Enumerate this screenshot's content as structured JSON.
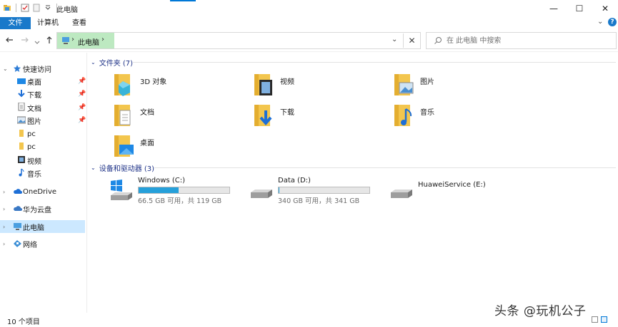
{
  "window": {
    "title": "此电脑",
    "controls": {
      "minimize": "—",
      "maximize": "☐",
      "close": "✕"
    }
  },
  "ribbon": {
    "tabs": [
      "文件",
      "计算机",
      "查看"
    ],
    "expand_glyph": "⌄",
    "help_glyph": "?"
  },
  "address": {
    "path": "此电脑",
    "search_placeholder": "在 此电脑 中搜索"
  },
  "sidebar": {
    "quick_access": "快速访问",
    "quick_items": [
      {
        "label": "桌面",
        "icon": "desktop-icon",
        "pinned": true
      },
      {
        "label": "下载",
        "icon": "download-icon",
        "pinned": true
      },
      {
        "label": "文档",
        "icon": "document-icon",
        "pinned": true
      },
      {
        "label": "图片",
        "icon": "picture-icon",
        "pinned": true
      },
      {
        "label": "pc",
        "icon": "folder-icon",
        "pinned": false
      },
      {
        "label": "pc",
        "icon": "folder-icon",
        "pinned": false
      },
      {
        "label": "视频",
        "icon": "video-icon",
        "pinned": false
      },
      {
        "label": "音乐",
        "icon": "music-icon",
        "pinned": false
      }
    ],
    "onedrive": "OneDrive",
    "huawei_cloud": "华为云盘",
    "this_pc": "此电脑",
    "network": "网络"
  },
  "content": {
    "folders_header": "文件夹 (7)",
    "folders": [
      {
        "label": "3D 对象",
        "icon": "3d-objects-folder-icon"
      },
      {
        "label": "视频",
        "icon": "videos-folder-icon"
      },
      {
        "label": "图片",
        "icon": "pictures-folder-icon"
      },
      {
        "label": "文档",
        "icon": "documents-folder-icon"
      },
      {
        "label": "下载",
        "icon": "downloads-folder-icon"
      },
      {
        "label": "音乐",
        "icon": "music-folder-icon"
      },
      {
        "label": "桌面",
        "icon": "desktop-folder-icon"
      }
    ],
    "devices_header": "设备和驱动器 (3)",
    "drives": [
      {
        "name": "Windows (C:)",
        "free": "66.5 GB 可用，共 119 GB",
        "used_fraction": 0.44,
        "icon": "windows-drive-icon"
      },
      {
        "name": "Data (D:)",
        "free": "340 GB 可用，共 341 GB",
        "used_fraction": 0.003,
        "icon": "hard-drive-icon"
      },
      {
        "name": "HuaweiService (E:)",
        "free": "",
        "used_fraction": null,
        "icon": "hard-drive-icon"
      }
    ]
  },
  "status": {
    "item_count": "10 个项目"
  },
  "watermark": "头条 @玩机公子",
  "colors": {
    "accent": "#0078d7",
    "file_tab": "#1979ca",
    "address_highlight": "#bde9c1",
    "selected_nav": "#cce8ff",
    "drive_bar": "#26a0da",
    "group_header": "#1e3287"
  }
}
